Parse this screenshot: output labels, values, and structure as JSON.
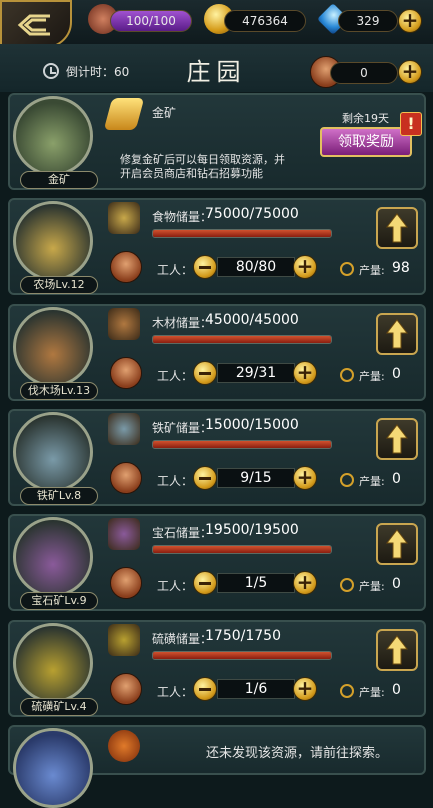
{
  "top": {
    "hp": "100/100",
    "gold": "476364",
    "gems": "329"
  },
  "header": {
    "timer": "倒计时：60",
    "title": "庄园",
    "workers": "0"
  },
  "gold_mine": {
    "name": "金矿",
    "circle_label": "金矿",
    "remaining": "剩余19天",
    "claim_button": "领取奖励",
    "desc_line1": "修复金矿后可以每日领取资源，并",
    "desc_line2": "开启会员商店和钻石招募功能"
  },
  "buildings": [
    {
      "name": "农场Lv.12",
      "res_label": "食物储量：",
      "res_value": "75000/75000",
      "fill": 1.0,
      "worker_label": "工人：",
      "workers": "80/80",
      "prod_label": "产量:",
      "prod": "98",
      "icon": "food-basket-icon",
      "color": "#c8a84a"
    },
    {
      "name": "伐木场Lv.13",
      "res_label": "木材储量：",
      "res_value": "45000/45000",
      "fill": 1.0,
      "worker_label": "工人：",
      "workers": "29/31",
      "prod_label": "产量:",
      "prod": "0",
      "icon": "wood-icon",
      "color": "#b07840"
    },
    {
      "name": "铁矿Lv.8",
      "res_label": "铁矿储量：",
      "res_value": "15000/15000",
      "fill": 1.0,
      "worker_label": "工人：",
      "workers": "9/15",
      "prod_label": "产量:",
      "prod": "0",
      "icon": "iron-ore-icon",
      "color": "#7a9aa8"
    },
    {
      "name": "宝石矿Lv.9",
      "res_label": "宝石储量：",
      "res_value": "19500/19500",
      "fill": 1.0,
      "worker_label": "工人：",
      "workers": "1/5",
      "prod_label": "产量:",
      "prod": "0",
      "icon": "gem-chest-icon",
      "color": "#8a5a9a"
    },
    {
      "name": "硫磺矿Lv.4",
      "res_label": "硫磺储量：",
      "res_value": "1750/1750",
      "fill": 1.0,
      "worker_label": "工人：",
      "workers": "1/6",
      "prod_label": "产量:",
      "prod": "0",
      "icon": "sulfur-icon",
      "color": "#b8a030"
    }
  ],
  "undiscovered": {
    "text": "还未发现该资源，请前往探索。"
  }
}
